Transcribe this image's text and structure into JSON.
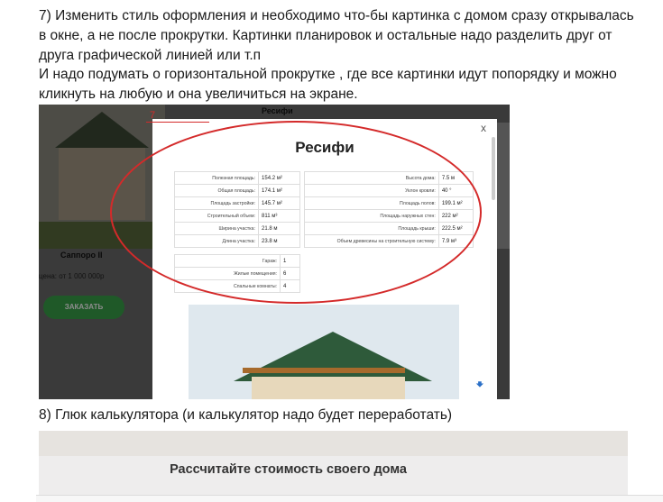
{
  "notes": {
    "p1": "7) Изменить стиль оформления и необходимо что-бы картинка с домом сразу открывалась в окне, а не после прокрутки. Картинки планировок и остальные надо разделить друг от друга графической линией или т.п",
    "p2": "И надо подумать о горизонтальной прокрутке , где все картинки идут попорядку и можно кликнуть на любую и она увеличиться на экране.",
    "p3": "8) Глюк калькулятора (и калькулятор надо будет переработать)"
  },
  "screenshot": {
    "bg_top_name": "Ресифи",
    "bg_house_name": "Саппоро II",
    "bg_price": "цена: от 1 000 000р",
    "bg_order_button": "ЗАКАЗАТЬ",
    "annotation_number": "7",
    "modal": {
      "close": "x",
      "title": "Ресифи",
      "table1": [
        {
          "label": "Полезная площадь:",
          "value": "154.2 м²"
        },
        {
          "label": "Общая площадь:",
          "value": "174.1 м²"
        },
        {
          "label": "Площадь застройки:",
          "value": "145.7 м²"
        },
        {
          "label": "Строительный объем:",
          "value": "811 м³"
        },
        {
          "label": "Ширина участка:",
          "value": "21.8 м"
        },
        {
          "label": "Длина участка:",
          "value": "23.8 м"
        }
      ],
      "table2": [
        {
          "label": "Высота дома:",
          "value": "7.5 м"
        },
        {
          "label": "Уклон кровли:",
          "value": "40 °"
        },
        {
          "label": "Площадь полов:",
          "value": "199.1 м²"
        },
        {
          "label": "Площадь наружных стен:",
          "value": "222 м²"
        },
        {
          "label": "Площадь крыши:",
          "value": "222.5 м²"
        },
        {
          "label": "Объем древесины на строительную систему:",
          "value": "7.9 м³"
        }
      ],
      "table3": [
        {
          "label": "Гараж:",
          "value": "1"
        },
        {
          "label": "Жилые помещения:",
          "value": "6"
        },
        {
          "label": "Спальные комнаты:",
          "value": "4"
        }
      ],
      "scroll_icon": "arrow-down-icon"
    }
  },
  "calculator": {
    "title": "Рассчитайте стоимость своего дома"
  }
}
